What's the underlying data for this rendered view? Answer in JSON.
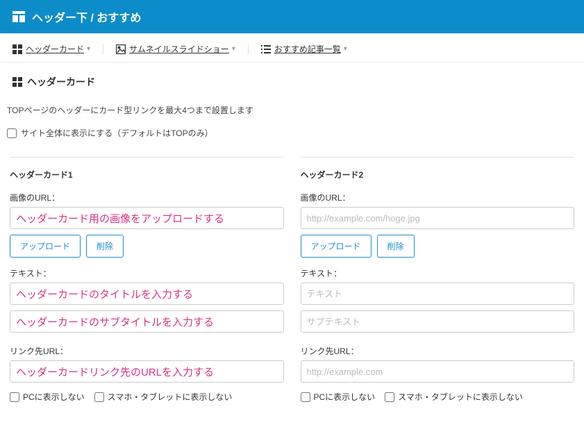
{
  "header": {
    "title": "ヘッダー下 / おすすめ"
  },
  "tabs": {
    "item0": "ヘッダーカード",
    "item1": "サムネイルスライドショー",
    "item2": "おすすめ記事一覧"
  },
  "section": {
    "title": "ヘッダーカード",
    "description": "TOPページのヘッダーにカード型リンクを最大4つまで設置します",
    "site_wide_label": "サイト全体に表示にする（デフォルトはTOPのみ）"
  },
  "card1": {
    "title": "ヘッダーカード1",
    "image_label": "画像のURL：",
    "image_value": "ヘッダーカード用の画像をアップロードする",
    "btn_upload": "アップロード",
    "btn_delete": "削除",
    "text_label": "テキスト：",
    "text_value": "ヘッダーカードのタイトルを入力する",
    "subtext_value": "ヘッダーカードのサブタイトルを入力する",
    "link_label": "リンク先URL：",
    "link_value": "ヘッダーカードリンク先のURLを入力する",
    "hide_pc": "PCに表示しない",
    "hide_sp": "スマホ・タブレットに表示しない"
  },
  "card2": {
    "title": "ヘッダーカード2",
    "image_label": "画像のURL：",
    "image_placeholder": "http://example.com/hoge.jpg",
    "btn_upload": "アップロード",
    "btn_delete": "削除",
    "text_label": "テキスト：",
    "text_placeholder": "テキスト",
    "subtext_placeholder": "サブテキスト",
    "link_label": "リンク先URL：",
    "link_placeholder": "http://example.com",
    "hide_pc": "PCに表示しない",
    "hide_sp": "スマホ・タブレットに表示しない"
  }
}
